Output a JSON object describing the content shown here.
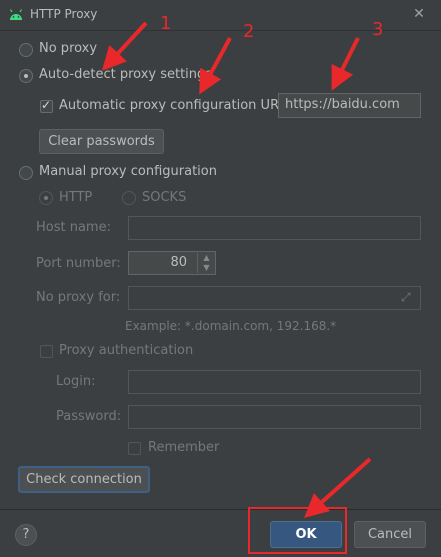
{
  "window": {
    "title": "HTTP Proxy"
  },
  "options": {
    "no_proxy": "No proxy",
    "auto_detect": "Auto-detect proxy settings",
    "pac_url_label": "Automatic proxy configuration URL:",
    "pac_url_value": "https://baidu.com",
    "clear_passwords": "Clear passwords",
    "manual": "Manual proxy configuration"
  },
  "manual": {
    "http": "HTTP",
    "socks": "SOCKS",
    "host_label": "Host name:",
    "port_label": "Port number:",
    "port_value": "80",
    "no_proxy_label": "No proxy for:",
    "example": "Example: *.domain.com, 192.168.*",
    "proxy_auth": "Proxy authentication",
    "login_label": "Login:",
    "password_label": "Password:",
    "remember": "Remember"
  },
  "buttons": {
    "check_connection": "Check connection",
    "help": "?",
    "ok": "OK",
    "cancel": "Cancel"
  },
  "annotations": {
    "one": "1",
    "two": "2",
    "three": "3",
    "color": "#e8282a"
  }
}
